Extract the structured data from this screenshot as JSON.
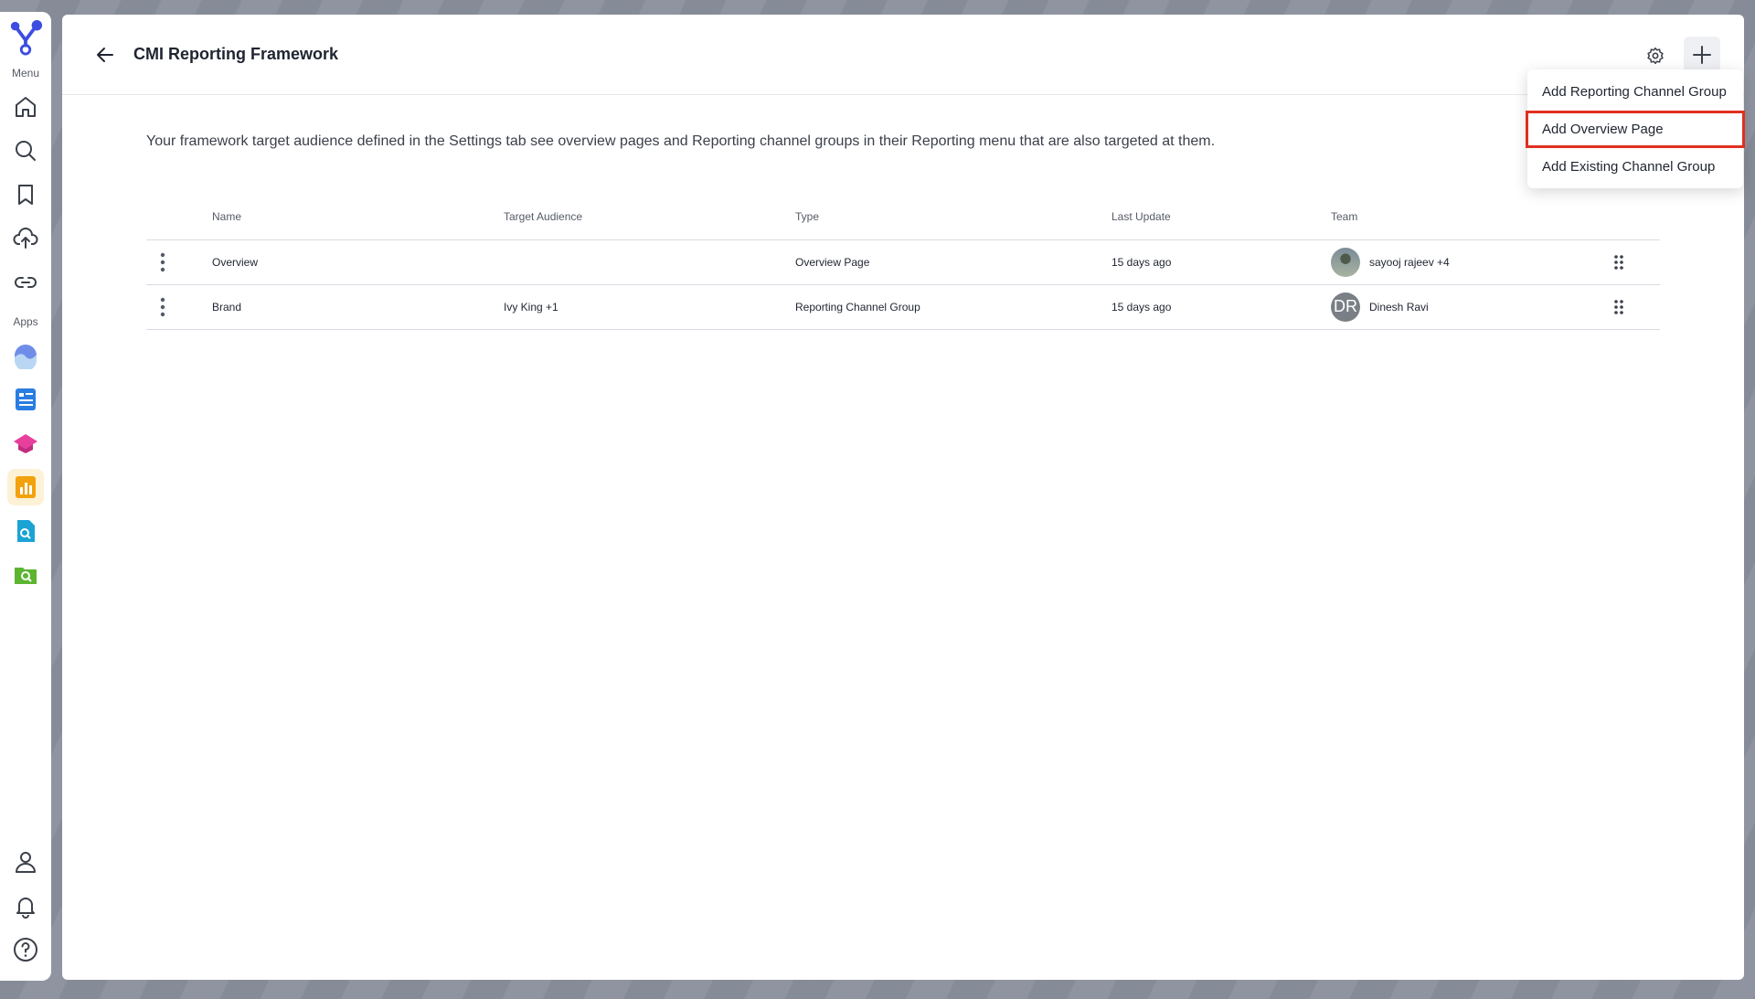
{
  "rail": {
    "menu_label": "Menu",
    "apps_label": "Apps",
    "menu_icons": [
      "home-icon",
      "search-icon",
      "bookmark-icon",
      "upload-cloud-icon",
      "link-icon"
    ],
    "app_icons": [
      "wave-app-icon",
      "form-app-icon",
      "cap-app-icon",
      "chart-app-icon",
      "doc-search-app-icon",
      "folder-search-app-icon"
    ],
    "bottom_icons": [
      "user-icon",
      "bell-icon",
      "help-icon"
    ]
  },
  "header": {
    "title": "CMI Reporting Framework"
  },
  "description": "Your framework target audience defined in the Settings tab see overview pages and Reporting channel groups in their Reporting menu that are also targeted at them.",
  "table": {
    "columns": [
      "Name",
      "Target Audience",
      "Type",
      "Last Update",
      "Team"
    ],
    "rows": [
      {
        "name": "Overview",
        "audience": "",
        "type": "Overview Page",
        "updated": "15 days ago",
        "team": "sayooj rajeev +4",
        "avatar": ""
      },
      {
        "name": "Brand",
        "audience": "Ivy King +1",
        "type": "Reporting Channel Group",
        "updated": "15 days ago",
        "team": "Dinesh Ravi",
        "avatar": "DR"
      }
    ]
  },
  "menu": {
    "items": [
      "Add Reporting Channel Group",
      "Add Overview Page",
      "Add Existing Channel Group"
    ]
  },
  "colors": {
    "accent": "#3d4de0",
    "highlight_border": "#e0301e"
  }
}
